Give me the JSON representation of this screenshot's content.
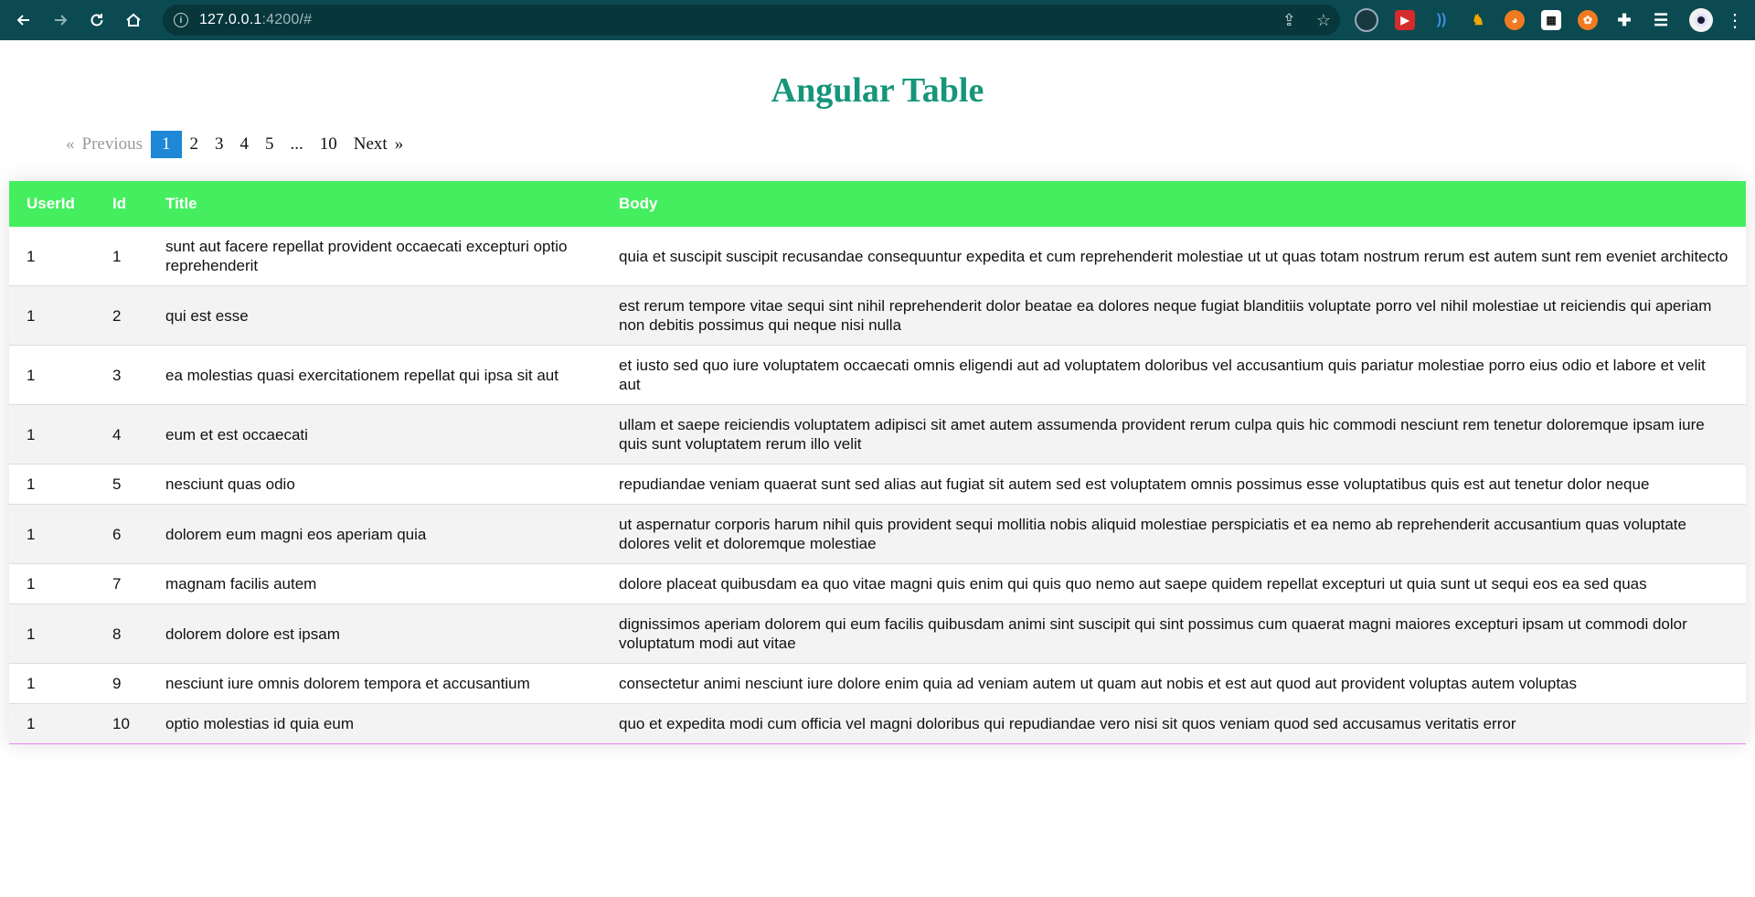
{
  "browser": {
    "url_host": "127.0.0.1",
    "url_rest": ":4200/#"
  },
  "page": {
    "title": "Angular Table"
  },
  "pagination": {
    "prev_label": "Previous",
    "next_label": "Next",
    "prev_arrow": "«",
    "next_arrow": "»",
    "pages": [
      "1",
      "2",
      "3",
      "4",
      "5",
      "...",
      "10"
    ],
    "current": "1"
  },
  "table": {
    "headers": {
      "userId": "UserId",
      "id": "Id",
      "title": "Title",
      "body": "Body"
    },
    "rows": [
      {
        "userId": "1",
        "id": "1",
        "title": "sunt aut facere repellat provident occaecati excepturi optio reprehenderit",
        "body": "quia et suscipit suscipit recusandae consequuntur expedita et cum reprehenderit molestiae ut ut quas totam nostrum rerum est autem sunt rem eveniet architecto"
      },
      {
        "userId": "1",
        "id": "2",
        "title": "qui est esse",
        "body": "est rerum tempore vitae sequi sint nihil reprehenderit dolor beatae ea dolores neque fugiat blanditiis voluptate porro vel nihil molestiae ut reiciendis qui aperiam non debitis possimus qui neque nisi nulla"
      },
      {
        "userId": "1",
        "id": "3",
        "title": "ea molestias quasi exercitationem repellat qui ipsa sit aut",
        "body": "et iusto sed quo iure voluptatem occaecati omnis eligendi aut ad voluptatem doloribus vel accusantium quis pariatur molestiae porro eius odio et labore et velit aut"
      },
      {
        "userId": "1",
        "id": "4",
        "title": "eum et est occaecati",
        "body": "ullam et saepe reiciendis voluptatem adipisci sit amet autem assumenda provident rerum culpa quis hic commodi nesciunt rem tenetur doloremque ipsam iure quis sunt voluptatem rerum illo velit"
      },
      {
        "userId": "1",
        "id": "5",
        "title": "nesciunt quas odio",
        "body": "repudiandae veniam quaerat sunt sed alias aut fugiat sit autem sed est voluptatem omnis possimus esse voluptatibus quis est aut tenetur dolor neque"
      },
      {
        "userId": "1",
        "id": "6",
        "title": "dolorem eum magni eos aperiam quia",
        "body": "ut aspernatur corporis harum nihil quis provident sequi mollitia nobis aliquid molestiae perspiciatis et ea nemo ab reprehenderit accusantium quas voluptate dolores velit et doloremque molestiae"
      },
      {
        "userId": "1",
        "id": "7",
        "title": "magnam facilis autem",
        "body": "dolore placeat quibusdam ea quo vitae magni quis enim qui quis quo nemo aut saepe quidem repellat excepturi ut quia sunt ut sequi eos ea sed quas"
      },
      {
        "userId": "1",
        "id": "8",
        "title": "dolorem dolore est ipsam",
        "body": "dignissimos aperiam dolorem qui eum facilis quibusdam animi sint suscipit qui sint possimus cum quaerat magni maiores excepturi ipsam ut commodi dolor voluptatum modi aut vitae"
      },
      {
        "userId": "1",
        "id": "9",
        "title": "nesciunt iure omnis dolorem tempora et accusantium",
        "body": "consectetur animi nesciunt iure dolore enim quia ad veniam autem ut quam aut nobis et est aut quod aut provident voluptas autem voluptas"
      },
      {
        "userId": "1",
        "id": "10",
        "title": "optio molestias id quia eum",
        "body": "quo et expedita modi cum officia vel magni doloribus qui repudiandae vero nisi sit quos veniam quod sed accusamus veritatis error"
      }
    ]
  }
}
